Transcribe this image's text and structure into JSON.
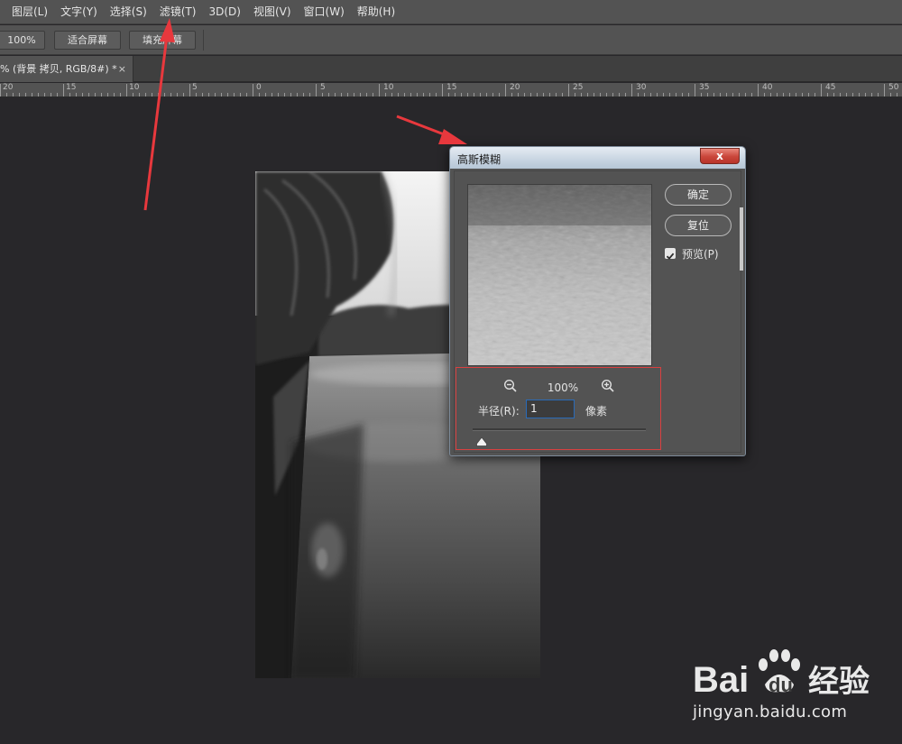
{
  "menubar": {
    "items": [
      "图层(L)",
      "文字(Y)",
      "选择(S)",
      "滤镜(T)",
      "3D(D)",
      "视图(V)",
      "窗口(W)",
      "帮助(H)"
    ]
  },
  "optionsbar": {
    "zoom_value": "100%",
    "fit_screen": "适合屏幕",
    "fill_screen": "填充屏幕"
  },
  "document": {
    "tab_title": "% (背景 拷贝, RGB/8#) *",
    "close_glyph": "×"
  },
  "ruler": {
    "labels": [
      "20",
      "15",
      "10",
      "5",
      "0",
      "5",
      "10",
      "15",
      "20",
      "25",
      "30",
      "35",
      "40",
      "45",
      "50"
    ]
  },
  "dialog": {
    "title": "高斯模糊",
    "close_glyph": "x",
    "ok_label": "确定",
    "reset_label": "复位",
    "preview_label": "预览(P)",
    "preview_checked": true,
    "zoom_level": "100%",
    "radius_label": "半径(R):",
    "radius_value": "1",
    "unit_label": "像素",
    "slider_value_fraction": 0.02
  },
  "watermark": {
    "brand": "Baidu经验",
    "site": "jingyan.baidu.com"
  },
  "colors": {
    "workspace": "#28272a",
    "panel": "#535353",
    "highlight_red": "#d94040",
    "arrow_red": "#e8383d"
  }
}
